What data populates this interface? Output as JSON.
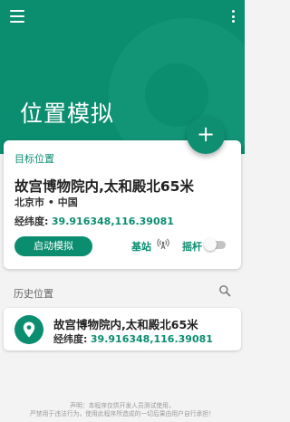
{
  "header": {
    "title": "位置模拟",
    "menu_icon": "hamburger-menu-icon",
    "more_icon": "more-vertical-icon",
    "color": "#0b8d70"
  },
  "fab": {
    "label": "+",
    "icon": "plus-icon"
  },
  "target": {
    "section_label": "目标位置",
    "name": "故宫博物院内,太和殿北65米",
    "city": "北京市 • 中国",
    "coord_label": "经纬度:",
    "coord_value": "39.916348,116.39081",
    "start_button": "启动模拟",
    "station_label": "基站",
    "station_icon": "antenna-signal-icon",
    "joystick_label": "摇杆",
    "joystick_toggle": "off"
  },
  "history": {
    "title": "历史位置",
    "search_icon": "search-icon",
    "items": [
      {
        "name": "故宫博物院内,太和殿北65米",
        "coord_label": "经纬度:",
        "coord_value": "39.916348,116.39081",
        "icon": "location-pin-icon"
      }
    ]
  },
  "footer": {
    "line1": "声明：本程序仅供开发人员测试使用，",
    "line2": "严禁用于违法行为，使用此程序所造成的一切后果由用户自行承担！"
  }
}
